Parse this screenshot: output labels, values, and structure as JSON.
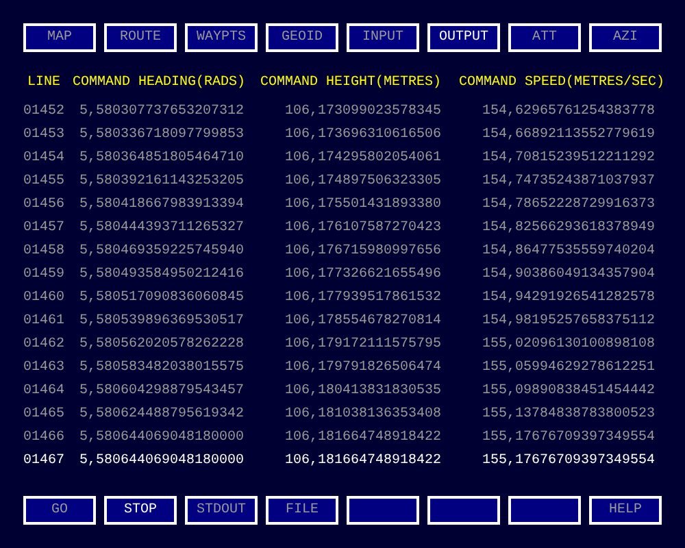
{
  "tabs": [
    {
      "label": "MAP",
      "selected": false
    },
    {
      "label": "ROUTE",
      "selected": false
    },
    {
      "label": "WAYPTS",
      "selected": false
    },
    {
      "label": "GEOID",
      "selected": false
    },
    {
      "label": "INPUT",
      "selected": false
    },
    {
      "label": "OUTPUT",
      "selected": true
    },
    {
      "label": "ATT",
      "selected": false
    },
    {
      "label": "AZI",
      "selected": false
    }
  ],
  "table": {
    "columns": [
      "LINE",
      "COMMAND HEADING(RADS)",
      "COMMAND HEIGHT(METRES)",
      "COMMAND SPEED(METRES/SEC)"
    ],
    "rows": [
      {
        "cells": [
          "01452",
          "5,580307737653207312",
          "106,173099023578345",
          "154,62965761254383778"
        ],
        "selected": false
      },
      {
        "cells": [
          "01453",
          "5,580336718097799853",
          "106,173696310616506",
          "154,66892113552779619"
        ],
        "selected": false
      },
      {
        "cells": [
          "01454",
          "5,580364851805464710",
          "106,174295802054061",
          "154,70815239512211292"
        ],
        "selected": false
      },
      {
        "cells": [
          "01455",
          "5,580392161143253205",
          "106,174897506323305",
          "154,74735243871037937"
        ],
        "selected": false
      },
      {
        "cells": [
          "01456",
          "5,580418667983913394",
          "106,175501431893380",
          "154,78652228729916373"
        ],
        "selected": false
      },
      {
        "cells": [
          "01457",
          "5,580444393711265327",
          "106,176107587270423",
          "154,82566293618378949"
        ],
        "selected": false
      },
      {
        "cells": [
          "01458",
          "5,580469359225745940",
          "106,176715980997656",
          "154,86477535559740204"
        ],
        "selected": false
      },
      {
        "cells": [
          "01459",
          "5,580493584950212416",
          "106,177326621655496",
          "154,90386049134357904"
        ],
        "selected": false
      },
      {
        "cells": [
          "01460",
          "5,580517090836060845",
          "106,177939517861532",
          "154,94291926541282578"
        ],
        "selected": false
      },
      {
        "cells": [
          "01461",
          "5,580539896369530517",
          "106,178554678270814",
          "154,98195257658375112"
        ],
        "selected": false
      },
      {
        "cells": [
          "01462",
          "5,580562020578262228",
          "106,179172111575795",
          "155,02096130100898108"
        ],
        "selected": false
      },
      {
        "cells": [
          "01463",
          "5,580583482038015575",
          "106,179791826506474",
          "155,05994629278612251"
        ],
        "selected": false
      },
      {
        "cells": [
          "01464",
          "5,580604298879543457",
          "106,180413831830535",
          "155,09890838451454442"
        ],
        "selected": false
      },
      {
        "cells": [
          "01465",
          "5,580624488795619342",
          "106,181038136353408",
          "155,13784838783800523"
        ],
        "selected": false
      },
      {
        "cells": [
          "01466",
          "5,580644069048180000",
          "106,181664748918422",
          "155,17676709397349554"
        ],
        "selected": false
      },
      {
        "cells": [
          "01467",
          "5,580644069048180000",
          "106,181664748918422",
          "155,17676709397349554"
        ],
        "selected": true
      }
    ]
  },
  "buttons": [
    {
      "kind": "labeled",
      "label": "GO",
      "active": false
    },
    {
      "kind": "labeled",
      "label": "STOP",
      "active": true
    },
    {
      "kind": "labeled",
      "label": "STDOUT",
      "active": false
    },
    {
      "kind": "labeled",
      "label": "FILE",
      "active": false
    },
    {
      "kind": "blank"
    },
    {
      "kind": "blank"
    },
    {
      "kind": "blank"
    },
    {
      "kind": "labeled",
      "label": "HELP",
      "active": false
    }
  ]
}
